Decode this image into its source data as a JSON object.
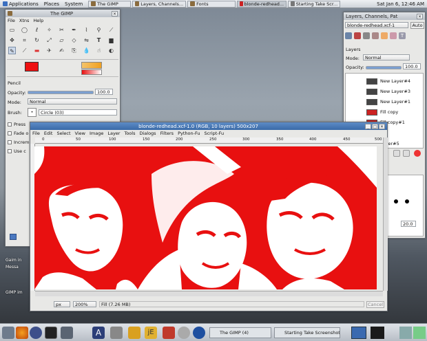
{
  "top_panel": {
    "menus": [
      "Applications",
      "Places",
      "System"
    ],
    "tasks": [
      "The GIMP",
      "Layers, Channels...",
      "Fonts",
      "blonde-redhead...",
      "Starting Take Scr..."
    ],
    "clock": "Sat Jan 6, 12:46 AM"
  },
  "toolbox": {
    "title": "The GIMP",
    "menu": [
      "File",
      "Xtns",
      "Help"
    ],
    "fg_color": "#ee1111",
    "options": {
      "tool_name": "Pencil",
      "opacity_label": "Opacity:",
      "opacity_value": "100.0",
      "mode_label": "Mode:",
      "mode_value": "Normal",
      "brush_label": "Brush:",
      "brush_value": "Circle (03)",
      "checks": [
        "Press",
        "Fade o",
        "Increm",
        "Use c"
      ]
    }
  },
  "image_window": {
    "title": "blonde-redhead.xcf-1.0 (RGB, 10 layers) 500x207",
    "menu": [
      "File",
      "Edit",
      "Select",
      "View",
      "Image",
      "Layer",
      "Tools",
      "Dialogs",
      "Filters",
      "Python-Fu",
      "Script-Fu"
    ],
    "ruler_ticks": [
      "0",
      "50",
      "100",
      "150",
      "200",
      "250",
      "300",
      "350",
      "400",
      "450",
      "500"
    ],
    "unit": "px",
    "zoom": "200%",
    "status": "Fill (7.26 MB)",
    "cancel_label": "Cancel",
    "figure_colors": {
      "red": "#e81010",
      "white": "#ffffff"
    }
  },
  "layers_dock": {
    "title": "Layers, Channels, Pat",
    "image_select": "blonde-redhead.xcf-1",
    "auto_label": "Auto",
    "section": "Layers",
    "mode_label": "Mode:",
    "mode_value": "Normal",
    "opacity_label": "Opacity:",
    "opacity_value": "100.0",
    "layers": [
      "New Layer#4",
      "New Layer#3",
      "New Layer#1",
      "Fill copy",
      "Fill copy#1",
      "Layer#5"
    ],
    "brush_spacing": "20.0"
  },
  "desktop": {
    "labels": [
      "Gaim in",
      "Messa",
      "GIMP im"
    ]
  },
  "taskbar": {
    "tasks": [
      "The GIMP (4)",
      "Starting Take Screenshot"
    ]
  }
}
